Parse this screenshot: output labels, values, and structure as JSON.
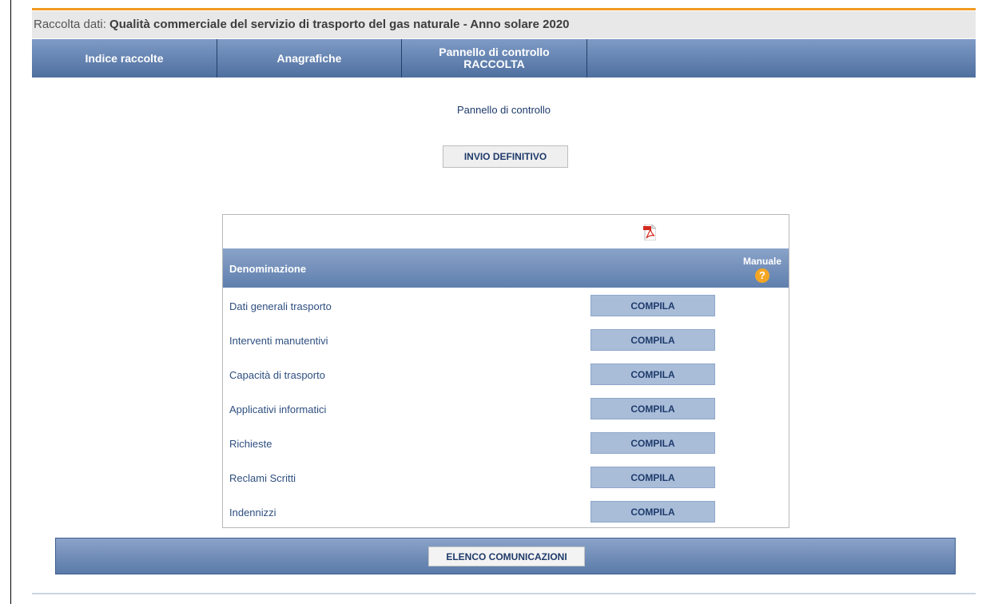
{
  "header": {
    "title_prefix": "Raccolta dati: ",
    "title_main": "Qualità commerciale del servizio di trasporto del gas naturale - Anno solare 2020"
  },
  "nav": [
    {
      "label": "Indice raccolte"
    },
    {
      "label": "Anagrafiche"
    },
    {
      "label": "Pannello di controllo\nRACCOLTA"
    }
  ],
  "main": {
    "section_title": "Pannello di controllo",
    "invio_button": "INVIO DEFINITIVO"
  },
  "table": {
    "header_denominazione": "Denominazione",
    "header_manuale": "Manuale",
    "help_glyph": "?",
    "pdf_icon": "pdf-icon",
    "rows": [
      {
        "label": "Dati generali trasporto",
        "action": "COMPILA"
      },
      {
        "label": "Interventi manutentivi",
        "action": "COMPILA"
      },
      {
        "label": "Capacità di trasporto",
        "action": "COMPILA"
      },
      {
        "label": "Applicativi informatici",
        "action": "COMPILA"
      },
      {
        "label": "Richieste",
        "action": "COMPILA"
      },
      {
        "label": "Reclami Scritti",
        "action": "COMPILA"
      },
      {
        "label": "Indennizzi",
        "action": "COMPILA"
      }
    ]
  },
  "footer": {
    "elenco_button": "ELENCO COMUNICAZIONI"
  },
  "colors": {
    "accent_orange": "#f29b21",
    "nav_blue": "#5a7aa8",
    "compila_bg": "#a9bdd9"
  }
}
